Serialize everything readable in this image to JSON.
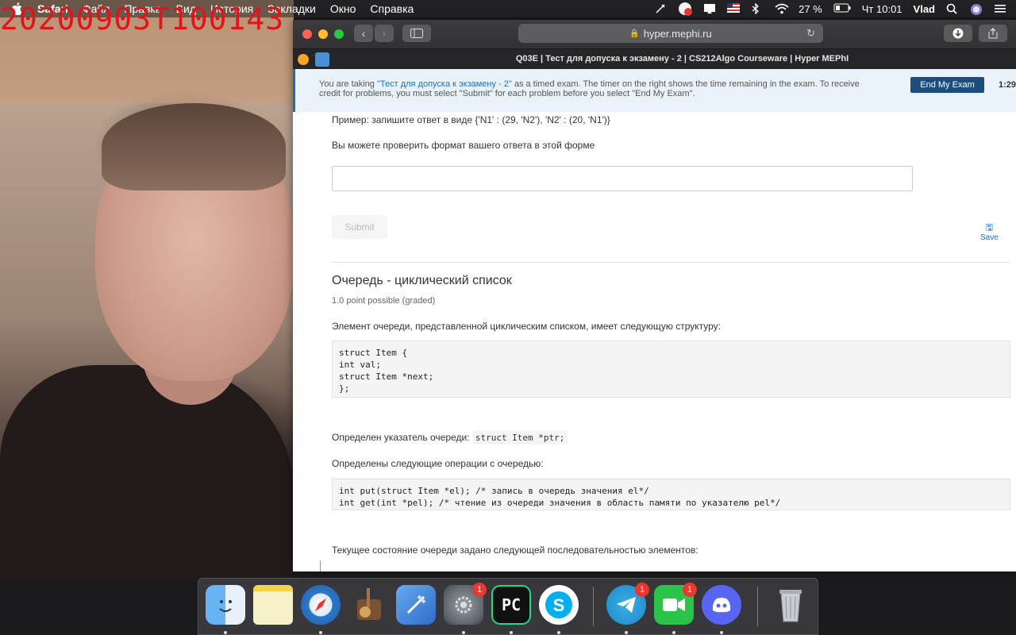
{
  "watermark": "20200903T100143",
  "menubar": {
    "items": [
      "Safari",
      "Файл",
      "Правка",
      "Вид",
      "История",
      "Закладки",
      "Окно",
      "Справка"
    ],
    "battery": "27 %",
    "clock": "Чт 10:01",
    "user": "Vlad",
    "icons": [
      "apple-icon",
      "pen-tool-icon",
      "notification-badge-icon",
      "airplay-icon",
      "flag-us-icon",
      "bluetooth-icon",
      "wifi-icon",
      "battery-icon",
      "search-icon",
      "siri-icon",
      "control-center-icon"
    ],
    "notif_count": "1"
  },
  "browser": {
    "url": "hyper.mephi.ru",
    "tab_title": "Q03E | Тест для допуска к экзамену - 2 | CS212Algo Courseware | Hyper MEPhI"
  },
  "banner": {
    "prefix": "You are taking ",
    "exam_link": "\"Тест для допуска к экзамену - 2\"",
    "suffix": " as a timed exam. The timer on the right shows the time remaining in the exam. To receive credit for problems, you must select \"Submit\" for each problem before you select \"End My Exam\".",
    "end_button": "End My Exam",
    "timer": "1:29:"
  },
  "content": {
    "example": "Пример: запишите ответ в виде {'N1' : (29, 'N2'), 'N2' : (20, 'N1')}",
    "check_format": "Вы можете проверить формат вашего ответа в этой форме",
    "answer_value": "",
    "submit_label": "Submit",
    "save_label": "Save",
    "question_title": "Очередь - циклический список",
    "points": "1.0 point possible (graded)",
    "struct_intro": "Элемент очереди, представленной циклическим списком, имеет следующую структуру:",
    "struct_code": "struct Item {\nint val;\nstruct Item *next;\n};",
    "pointer_label": "Определен указатель очереди:",
    "pointer_code": "struct Item *ptr;",
    "ops_intro": "Определены следующие операции с очередью:",
    "ops_code": "int put(struct Item *el); /* запись в очередь значения el*/\nint get(int *pel); /* чтение из очереди значения в область памяти по указателю pel*/",
    "state_intro": "Текущее состояние очереди задано следующей последовательностью элементов:"
  },
  "dock": {
    "apps": [
      {
        "name": "finder",
        "badge": ""
      },
      {
        "name": "notes",
        "badge": ""
      },
      {
        "name": "safari",
        "badge": ""
      },
      {
        "name": "garageband",
        "badge": ""
      },
      {
        "name": "xcode",
        "badge": ""
      },
      {
        "name": "system-preferences",
        "badge": "1"
      },
      {
        "name": "pycharm",
        "label": "PC",
        "badge": ""
      },
      {
        "name": "skype",
        "badge": ""
      },
      {
        "name": "telegram",
        "badge": "1"
      },
      {
        "name": "facetime",
        "badge": "1"
      },
      {
        "name": "discord",
        "badge": ""
      },
      {
        "name": "trash",
        "badge": ""
      }
    ]
  }
}
